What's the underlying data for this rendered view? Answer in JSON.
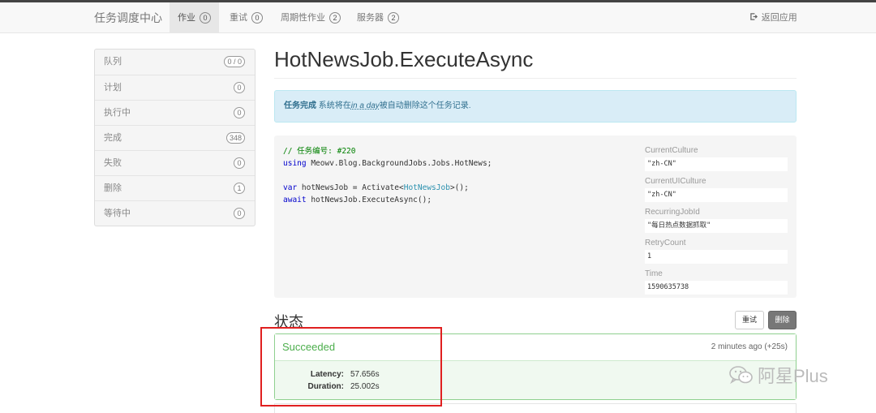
{
  "navbar": {
    "brand": "任务调度中心",
    "links": [
      {
        "label": "作业",
        "count": "0"
      },
      {
        "label": "重试",
        "count": "0"
      },
      {
        "label": "周期性作业",
        "count": "2"
      },
      {
        "label": "服务器",
        "count": "2"
      }
    ],
    "back_label": "返回应用",
    "back_icon": "sign-out-icon"
  },
  "sidebar": {
    "items": [
      {
        "label": "队列",
        "count": "0 / 0"
      },
      {
        "label": "计划",
        "count": "0"
      },
      {
        "label": "执行中",
        "count": "0"
      },
      {
        "label": "完成",
        "count": "348"
      },
      {
        "label": "失败",
        "count": "0"
      },
      {
        "label": "删除",
        "count": "1"
      },
      {
        "label": "等待中",
        "count": "0"
      }
    ]
  },
  "job": {
    "title": "HotNewsJob.ExecuteAsync",
    "alert": {
      "strong": "任务完成",
      "before": " 系统将在",
      "time": "in a day",
      "after": "被自动删除这个任务记录."
    },
    "code": {
      "comment": "// 任务编号: #220",
      "using_kw": "using",
      "using_ns": " Meowv.Blog.BackgroundJobs.Jobs.HotNews;",
      "line3_kw": "var",
      "line3_a": " hotNewsJob = Activate<",
      "line3_type": "HotNewsJob",
      "line3_b": ">();",
      "line4_kw": "await",
      "line4_rest": " hotNewsJob.ExecuteAsync();"
    },
    "params": [
      {
        "name": "CurrentCulture",
        "value": "\"zh-CN\""
      },
      {
        "name": "CurrentUICulture",
        "value": "\"zh-CN\""
      },
      {
        "name": "RecurringJobId",
        "value": "\"每日热点数据抓取\""
      },
      {
        "name": "RetryCount",
        "value": "1"
      },
      {
        "name": "Time",
        "value": "1590635738"
      }
    ]
  },
  "state": {
    "title": "状态",
    "retry_label": "重试",
    "delete_label": "删除",
    "status": "Succeeded",
    "time": "2 minutes ago (+25s)",
    "latency_label": "Latency:",
    "latency_value": "57.656s",
    "duration_label": "Duration:",
    "duration_value": "25.002s"
  },
  "watermark": {
    "text": "阿星Plus",
    "icon": "wechat-icon"
  },
  "colors": {
    "alert_bg": "#d9edf7",
    "success": "#4cae4c",
    "highlight": "#e02020"
  }
}
